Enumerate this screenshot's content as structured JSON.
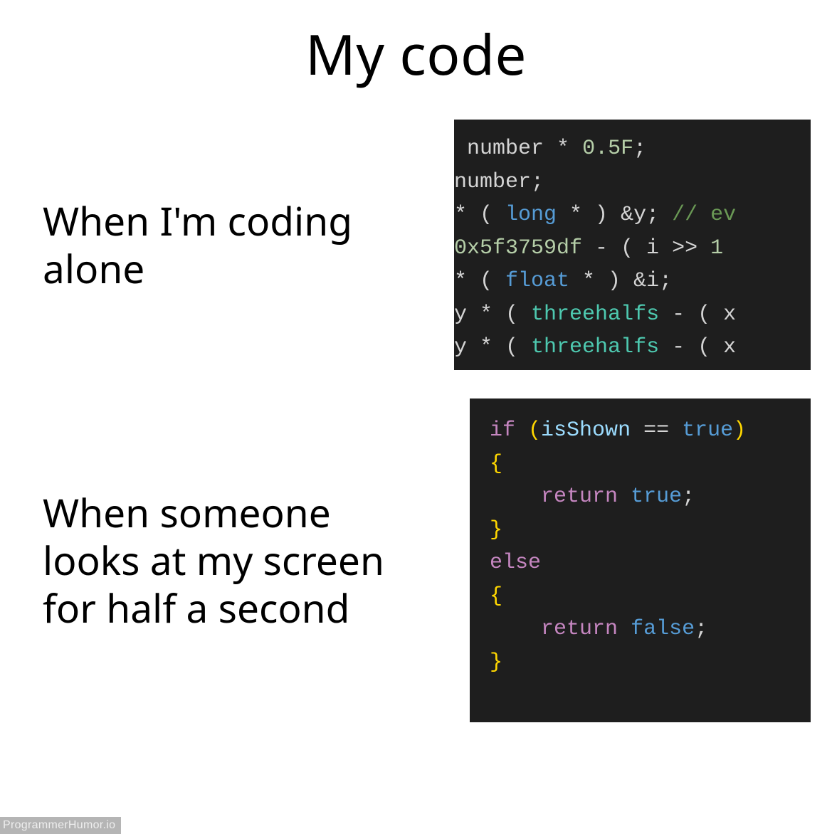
{
  "title": "My code",
  "rows": [
    {
      "caption": "When I'm coding alone",
      "code_tokens": [
        [
          {
            "t": " number ",
            "c": "plain"
          },
          {
            "t": "*",
            "c": "plain"
          },
          {
            "t": " ",
            "c": "plain"
          },
          {
            "t": "0.5F",
            "c": "num"
          },
          {
            "t": ";",
            "c": "plain"
          }
        ],
        [
          {
            "t": "number",
            "c": "plain"
          },
          {
            "t": ";",
            "c": "plain"
          }
        ],
        [
          {
            "t": "*",
            "c": "plain"
          },
          {
            "t": " ( ",
            "c": "plain"
          },
          {
            "t": "long",
            "c": "kw-blue"
          },
          {
            "t": " * ) ",
            "c": "plain"
          },
          {
            "t": "&",
            "c": "plain"
          },
          {
            "t": "y",
            "c": "plain"
          },
          {
            "t": "; ",
            "c": "plain"
          },
          {
            "t": "// ev",
            "c": "comment"
          }
        ],
        [
          {
            "t": "0x5f3759df",
            "c": "num"
          },
          {
            "t": " - ( i ",
            "c": "plain"
          },
          {
            "t": ">>",
            "c": "plain"
          },
          {
            "t": " ",
            "c": "plain"
          },
          {
            "t": "1",
            "c": "num"
          }
        ],
        [
          {
            "t": "*",
            "c": "plain"
          },
          {
            "t": " ( ",
            "c": "plain"
          },
          {
            "t": "float",
            "c": "kw-blue"
          },
          {
            "t": " * ) ",
            "c": "plain"
          },
          {
            "t": "&",
            "c": "plain"
          },
          {
            "t": "i",
            "c": "plain"
          },
          {
            "t": ";",
            "c": "plain"
          }
        ],
        [
          {
            "t": "y ",
            "c": "plain"
          },
          {
            "t": "*",
            "c": "plain"
          },
          {
            "t": " ( ",
            "c": "plain"
          },
          {
            "t": "threehalfs",
            "c": "local"
          },
          {
            "t": " - ( x",
            "c": "plain"
          }
        ],
        [
          {
            "t": "y ",
            "c": "plain"
          },
          {
            "t": "*",
            "c": "plain"
          },
          {
            "t": " ( ",
            "c": "plain"
          },
          {
            "t": "threehalfs",
            "c": "local"
          },
          {
            "t": " - ( x",
            "c": "plain"
          }
        ]
      ]
    },
    {
      "caption": "When someone looks at my screen for half a second",
      "code_tokens": [
        [
          {
            "t": "if",
            "c": "kw-pink"
          },
          {
            "t": " ",
            "c": "plain"
          },
          {
            "t": "(",
            "c": "brace-y"
          },
          {
            "t": "isShown",
            "c": "ident"
          },
          {
            "t": " == ",
            "c": "plain"
          },
          {
            "t": "true",
            "c": "kw-blue"
          },
          {
            "t": ")",
            "c": "brace-y"
          }
        ],
        [
          {
            "t": "{",
            "c": "brace-y"
          }
        ],
        [
          {
            "t": "    ",
            "c": "plain"
          },
          {
            "t": "return",
            "c": "kw-pink"
          },
          {
            "t": " ",
            "c": "plain"
          },
          {
            "t": "true",
            "c": "kw-blue"
          },
          {
            "t": ";",
            "c": "plain"
          }
        ],
        [
          {
            "t": "}",
            "c": "brace-y"
          }
        ],
        [
          {
            "t": "else",
            "c": "kw-pink"
          }
        ],
        [
          {
            "t": "{",
            "c": "brace-y"
          }
        ],
        [
          {
            "t": "    ",
            "c": "plain"
          },
          {
            "t": "return",
            "c": "kw-pink"
          },
          {
            "t": " ",
            "c": "plain"
          },
          {
            "t": "false",
            "c": "kw-blue"
          },
          {
            "t": ";",
            "c": "plain"
          }
        ],
        [
          {
            "t": "}",
            "c": "brace-y"
          }
        ]
      ]
    }
  ],
  "watermark": "ProgrammerHumor.io"
}
